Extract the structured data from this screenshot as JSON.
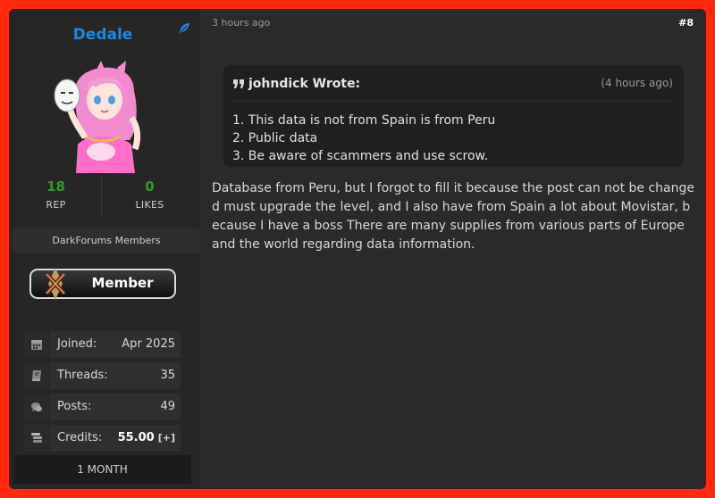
{
  "user": {
    "name": "Dedale",
    "rep": {
      "value": "18",
      "label": "REP"
    },
    "likes": {
      "value": "0",
      "label": "LIKES"
    },
    "group": "DarkForums Members",
    "badge_label": "Member",
    "info": [
      {
        "icon": "calendar-icon",
        "label": "Joined:",
        "value": "Apr 2025"
      },
      {
        "icon": "book-icon",
        "label": "Threads:",
        "value": "35"
      },
      {
        "icon": "comments-icon",
        "label": "Posts:",
        "value": "49"
      },
      {
        "icon": "coins-icon",
        "label": "Credits:",
        "value": "55.00",
        "extra": "[+]"
      }
    ],
    "subscription": "1 MONTH"
  },
  "post": {
    "time": "3 hours ago",
    "number": "#8",
    "quote": {
      "author_line": "johndick Wrote:",
      "time": "(4 hours ago)",
      "lines": [
        "1. This data is not from Spain is from Peru",
        "2. Public data",
        "3. Be aware of scammers and use scrow."
      ]
    },
    "body": "Database from Peru, but I forgot to fill it because the post can not be changed must upgrade the level, and I also have from Spain a lot about Movistar, because I have a boss There are many supplies from various parts of Europe and the world regarding data information."
  },
  "colors": {
    "username": "#1e88e5",
    "stat_number": "#2e9d2a",
    "border": "#ff2a0e"
  }
}
